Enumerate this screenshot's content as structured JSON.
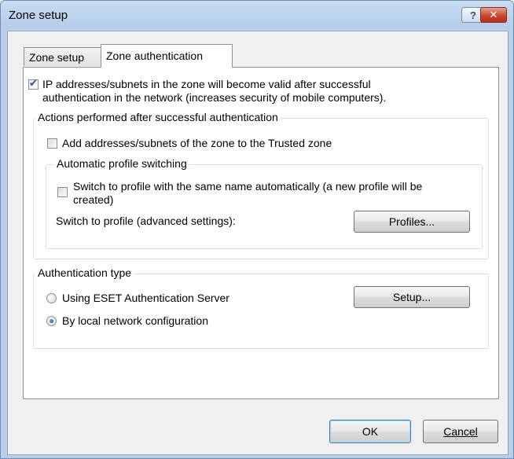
{
  "window": {
    "title": "Zone setup"
  },
  "titlebar": {
    "help_label": "?",
    "close_label": "✕"
  },
  "tabs": [
    {
      "label": "Zone setup",
      "selected": false
    },
    {
      "label": "Zone authentication",
      "selected": true
    }
  ],
  "valid_after_auth": {
    "checked": true,
    "line1": "IP addresses/subnets in the zone will become valid after successful",
    "line2": "authentication in the network (increases security of mobile computers)."
  },
  "actions_group": {
    "legend": "Actions performed after successful authentication",
    "add_trusted": {
      "checked": false,
      "label": "Add addresses/subnets of the zone to the Trusted zone"
    },
    "profile_group": {
      "legend": "Automatic profile switching",
      "switch_same_name": {
        "checked": false,
        "line1": "Switch to profile with the same name automatically (a new profile will be",
        "line2": "created)"
      },
      "advanced_label": "Switch to profile (advanced settings):",
      "profiles_button": "Profiles..."
    }
  },
  "auth_group": {
    "legend": "Authentication type",
    "options": [
      {
        "label": "Using ESET Authentication Server",
        "selected": false
      },
      {
        "label": "By local network configuration",
        "selected": true
      }
    ],
    "setup_button": "Setup..."
  },
  "footer": {
    "ok_label": "OK",
    "cancel_label": "Cancel"
  }
}
